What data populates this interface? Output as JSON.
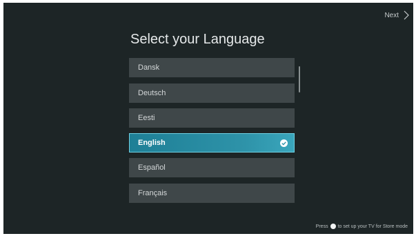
{
  "header": {
    "next_label": "Next",
    "next_icon": "chevron-right-icon"
  },
  "title": "Select your Language",
  "languages": [
    {
      "label": "Dansk",
      "selected": false
    },
    {
      "label": "Deutsch",
      "selected": false
    },
    {
      "label": "Eesti",
      "selected": false
    },
    {
      "label": "English",
      "selected": true
    },
    {
      "label": "Español",
      "selected": false
    },
    {
      "label": "Français",
      "selected": false
    }
  ],
  "selected_icon": "check-circle-icon",
  "footer": {
    "press": "Press",
    "button_icon": "remote-button-icon",
    "text": "to set up your TV for Store mode"
  },
  "colors": {
    "background": "#1d2526",
    "item": "#3f4749",
    "selected": "#2e93a9"
  }
}
